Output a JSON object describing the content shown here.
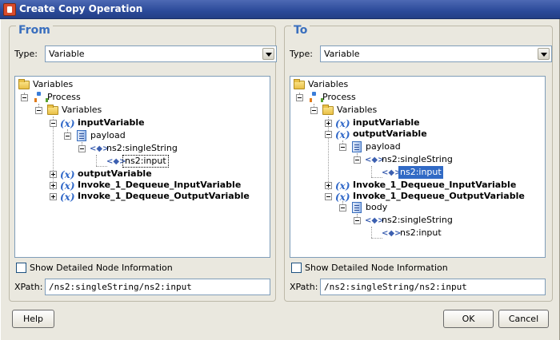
{
  "window": {
    "title": "Create Copy Operation"
  },
  "from": {
    "heading": "From",
    "type_label": "Type:",
    "type_value": "Variable",
    "tree": {
      "variables": "Variables",
      "process": "Process",
      "sub_variables": "Variables",
      "input_variable": "inputVariable",
      "payload": "payload",
      "single_string": "ns2:singleString",
      "ns2_input": "ns2:input",
      "output_variable": "outputVariable",
      "invoke_input": "Invoke_1_Dequeue_InputVariable",
      "invoke_output": "Invoke_1_Dequeue_OutputVariable"
    },
    "show_detail_label": "Show Detailed Node Information",
    "xpath_label": "XPath:",
    "xpath_value": "/ns2:singleString/ns2:input"
  },
  "to": {
    "heading": "To",
    "type_label": "Type:",
    "type_value": "Variable",
    "tree": {
      "variables": "Variables",
      "process": "Process",
      "sub_variables": "Variables",
      "input_variable": "inputVariable",
      "output_variable": "outputVariable",
      "payload": "payload",
      "single_string": "ns2:singleString",
      "ns2_input": "ns2:input",
      "invoke_input": "Invoke_1_Dequeue_InputVariable",
      "invoke_output": "Invoke_1_Dequeue_OutputVariable",
      "body": "body",
      "body_single_string": "ns2:singleString",
      "body_ns2_input": "ns2:input"
    },
    "show_detail_label": "Show Detailed Node Information",
    "xpath_label": "XPath:",
    "xpath_value": "/ns2:singleString/ns2:input"
  },
  "buttons": {
    "help": "Help",
    "ok": "OK",
    "cancel": "Cancel"
  }
}
